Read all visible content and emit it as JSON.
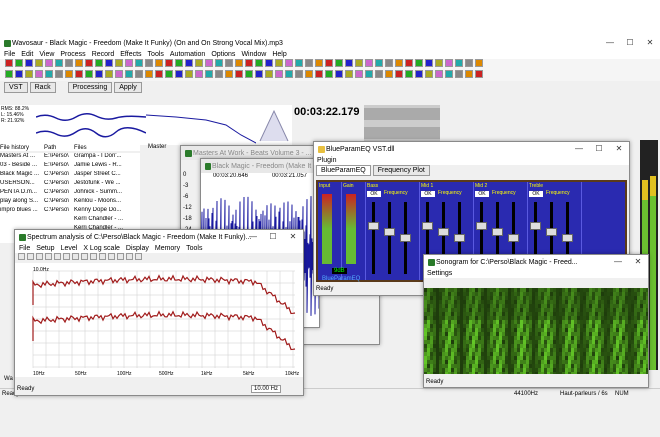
{
  "main": {
    "title": "Wavosaur - Black Magic - Freedom (Make It Funky) (On and On Strong Vocal Mix).mp3",
    "menu": [
      "File",
      "Edit",
      "View",
      "Process",
      "Record",
      "Effects",
      "Tools",
      "Automation",
      "Options",
      "Window",
      "Help"
    ],
    "tabs": {
      "vst": "VST",
      "rack": "Rack",
      "processing": "Processing",
      "apply": "Apply"
    },
    "time": "00:03:22.179",
    "master": "Master",
    "file_cols": [
      "File history",
      "Path",
      "Files"
    ],
    "files": [
      {
        "name": "Masters At ...",
        "path": "E:\\Perso\\",
        "file": "Grampa - I Don'..."
      },
      {
        "name": "03 - Beside ...",
        "path": "E:\\Perso\\",
        "file": "Jamie Lewis - R..."
      },
      {
        "name": "Black Magic ...",
        "path": "C:\\Perso\\",
        "file": "Jasper Street C..."
      },
      {
        "name": "USERSON...",
        "path": "C:\\Perso\\",
        "file": "Jestofunk - We ..."
      },
      {
        "name": "PENTA D.m...",
        "path": "C:\\Perso\\",
        "file": "Johnick - Summ..."
      },
      {
        "name": "play along S...",
        "path": "C:\\Perso\\",
        "file": "Kenlou - Moons..."
      },
      {
        "name": "impro blues ...",
        "path": "C:\\Perso\\",
        "file": "Kenny Dope Do..."
      },
      {
        "name": "",
        "path": "",
        "file": "Kerri Chandler - ..."
      },
      {
        "name": "",
        "path": "",
        "file": "Kerri Chandler - ..."
      },
      {
        "name": "",
        "path": "",
        "file": "Lamott Atkins - ..."
      }
    ],
    "levels": {
      "rms": "RMS: 88.2%",
      "l": "L: 15.46%",
      "r": "R: 21.92%"
    },
    "db": [
      "0",
      "-3",
      "-6",
      "-12",
      "-18",
      "-24"
    ],
    "status": {
      "ready": "Ready",
      "rate": "44100Hz",
      "out": "Haut-parleurs / 6s",
      "num": "NUM",
      "bits": "16 bit STEREO"
    }
  },
  "masters": {
    "title": "Masters At Work - Beats Volume 3 - ..."
  },
  "bm": {
    "title": "Black Magic - Freedom (Make It ...",
    "t1": "00:03:20.646",
    "t2": "00:03:21.057"
  },
  "eq": {
    "title": "BlueParamEQ VST.dll",
    "plugin": "Plugin",
    "tab1": "BlueParamEQ",
    "tab2": "Frequency Plot",
    "bands": [
      "Input",
      "Gain",
      "Bass",
      "Mid 1",
      "Mid 2",
      "Treble"
    ],
    "ok": "OK",
    "freq": "Frequency",
    "q": "Q",
    "gain_val": "9dB",
    "ready": "Ready",
    "name": "BlueParamEQ",
    "rl": "R · LO"
  },
  "spec": {
    "title": "Spectrum analysis of C:\\Perso\\Black Magic - Freedom (Make It Funky)...",
    "menu": [
      "File",
      "Setup",
      "Level",
      "X Log scale",
      "Display",
      "Memory",
      "Tools"
    ],
    "xticks": [
      "10Hz",
      "50Hz",
      "100Hz",
      "500Hz",
      "1kHz",
      "5kHz",
      "10kHz"
    ],
    "top": "10.0Hz",
    "ready": "Ready",
    "freq": "10.00 Hz"
  },
  "sono": {
    "title": "Sonogram for C:\\Perso\\Black Magic - Freed...",
    "settings": "Settings",
    "ready": "Ready"
  },
  "colors": {
    "wave": "#1a1aa0",
    "spec": "#a01a1a",
    "eqbg": "#2a2ab0",
    "sono": "#3a8a2a"
  }
}
